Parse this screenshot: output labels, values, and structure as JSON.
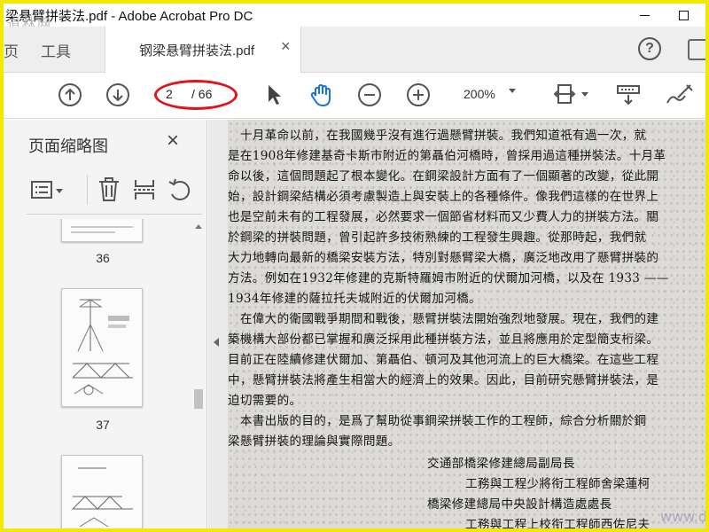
{
  "window": {
    "title": "梁悬臂拼装法.pdf - Adobe Acrobat Pro DC",
    "watermark": "道林网"
  },
  "tabs": {
    "home_fragment": "页",
    "tools": "工具",
    "document": "钢梁悬臂拼装法.pdf",
    "close": "×",
    "help": "?"
  },
  "toolbar": {
    "current_page": "2",
    "total_pages": "/ 66",
    "zoom": "200%",
    "icons": [
      "prev-page",
      "next-page",
      "select-pointer",
      "hand",
      "zoom-out",
      "zoom-in",
      "fit-width",
      "scrolling-mode",
      "sign"
    ]
  },
  "sidebar": {
    "title": "页面缩略图",
    "close": "×",
    "thumbnails": [
      {
        "label": "36"
      },
      {
        "label": "37"
      },
      {
        "label": ""
      }
    ]
  },
  "document": {
    "lines": [
      "　十月革命以前，在我國幾乎沒有進行過懸臂拼裝。我們知道祇有過一次，就",
      "是在1908年修建基奇卡斯市附近的第聶伯河橋時，曾採用過這種拼裝法。十月革",
      "命以後，這個問題起了根本變化。在鋼梁設計方面有了一個顯著的改變，從此開",
      "始，設計鋼梁結構必須考慮製造上與安裝上的各種條件。像我們這樣的在世界上",
      "也是空前未有的工程發展，必然要求一個節省材料而又少費人力的拼裝方法。關",
      "於鋼梁的拼裝問題，曾引起許多技術熟練的工程發生興趣。從那時起，我們就",
      "大力地轉向最新的橋梁安裝方法，特別對懸臂梁大橋，廣泛地改用了懸臂拼裝的",
      "方法。例如在1932年修建的克斯特羅姆市附近的伏爾加河橋，以及在 1933 ——",
      "1934年修建的薩拉托夫城附近的伏爾加河橋。",
      "　在偉大的衛國戰爭期間和戰後，懸臂拼裝法開始強烈地發展。現在，我們的建",
      "築機構大部份都已掌握和廣泛採用此種拼裝方法，並且將應用於定型簡支桁梁。",
      "目前正在陸續修建伏爾加、第聶伯、頓河及其他河流上的巨大橋梁。在這些工程",
      "中，懸臂拼裝法將產生相當大的經濟上的效果。因此，目前研究懸臂拼裝法，是",
      "迫切需要的。",
      "　本書出版的目的，是爲了幫助從事鋼梁拼裝工作的工程師，綜合分析關於鋼",
      "梁懸臂拼裝的理論與實際問題。"
    ],
    "signatures": [
      "交通部橋梁修建總局副局長",
      "工務與工程少將衔工程師舍梁蓮柯",
      "橋梁修建總局中央設計構造處處長",
      "工務與工程上校衔工程師西佐尼夫"
    ],
    "watermark": "www.daolinw.com"
  }
}
